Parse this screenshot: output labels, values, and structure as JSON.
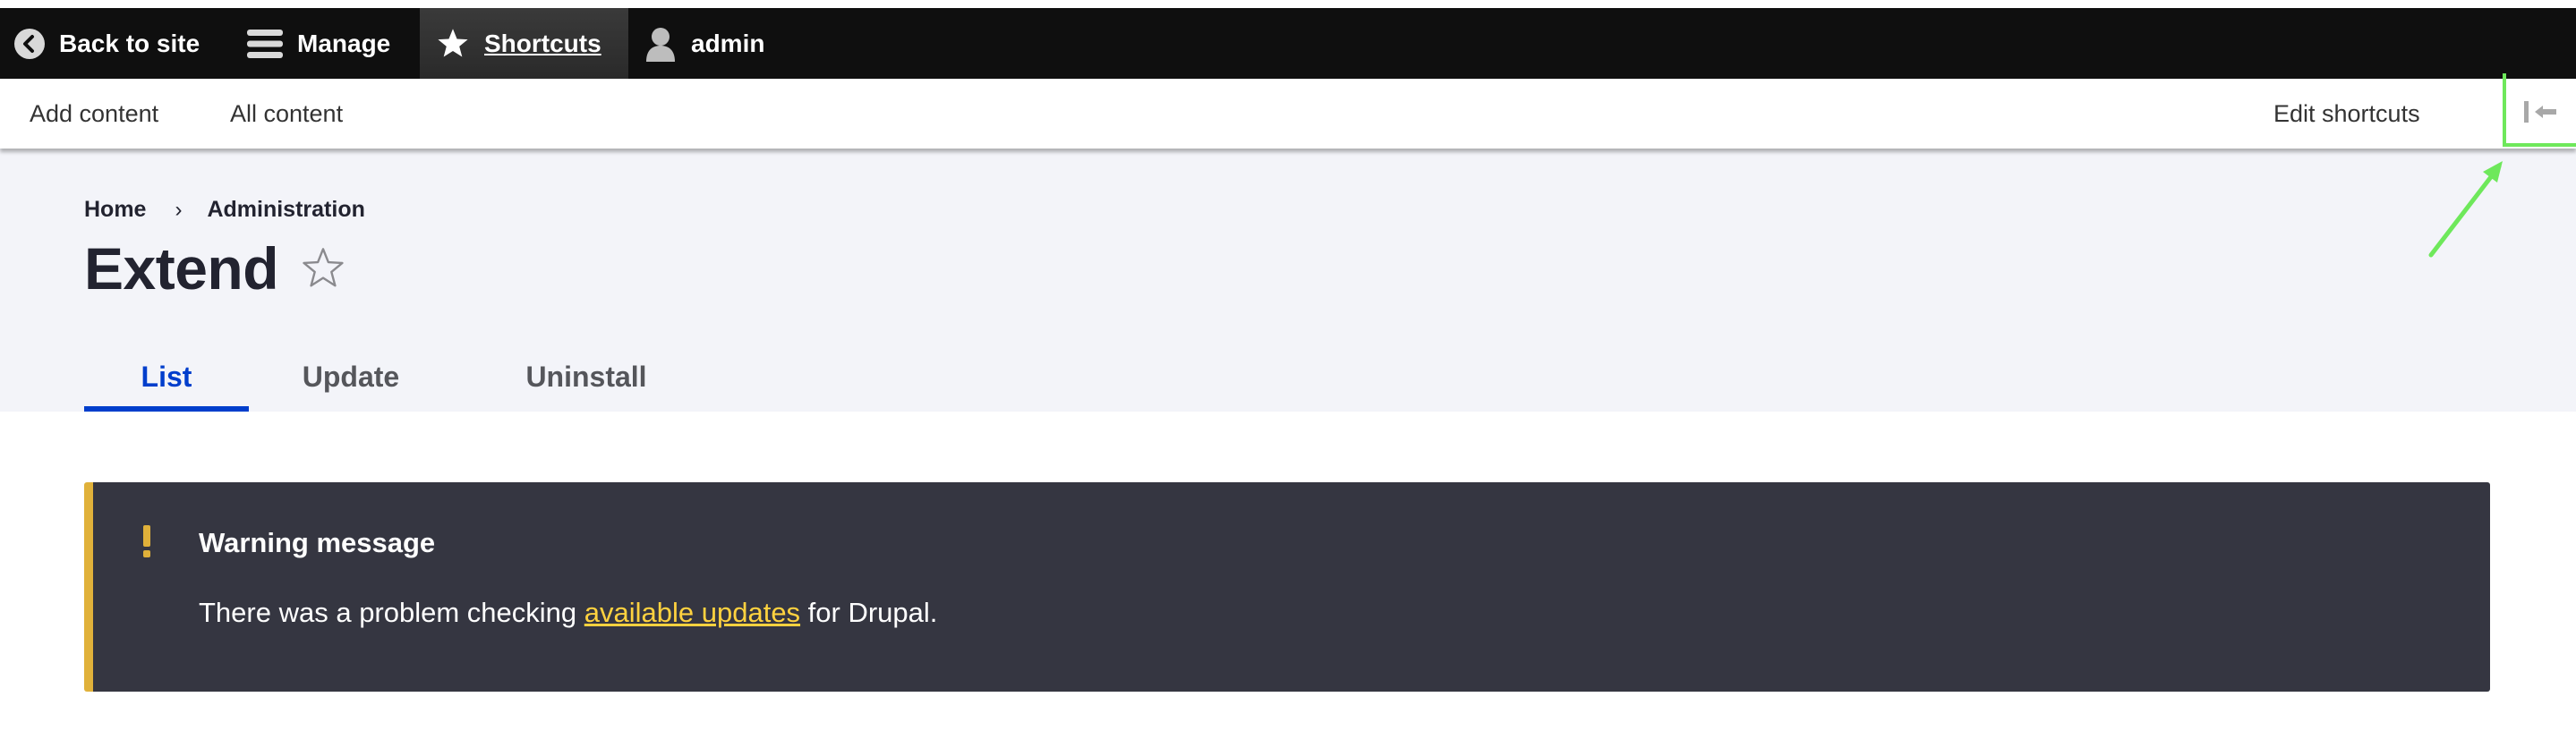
{
  "toolbar": {
    "back_label": "Back to site",
    "manage_label": "Manage",
    "shortcuts_label": "Shortcuts",
    "user_label": "admin"
  },
  "tray": {
    "add_content": "Add content",
    "all_content": "All content",
    "edit_shortcuts": "Edit shortcuts"
  },
  "breadcrumb": {
    "items": [
      "Home",
      "Administration"
    ],
    "separator": "›"
  },
  "page": {
    "title": "Extend",
    "star_glyph": "☆"
  },
  "tabs": [
    {
      "label": "List",
      "active": true
    },
    {
      "label": "Update",
      "active": false
    },
    {
      "label": "Uninstall",
      "active": false
    }
  ],
  "message": {
    "title": "Warning message",
    "text_before": "There was a problem checking ",
    "link_text": "available updates",
    "text_after": " for Drupal."
  },
  "colors": {
    "toolbar_bg": "#0f0f0f",
    "active_tab": "#003ecc",
    "warning_accent": "#e0b13a",
    "message_bg": "#353641",
    "link_yellow": "#ffd23f",
    "annotation_green": "#6ee85b"
  },
  "icons": {
    "back": "chevron-left-circle-icon",
    "manage": "hamburger-menu-icon",
    "shortcuts": "star-icon",
    "user": "user-icon",
    "toggle": "collapse-tray-icon",
    "warning": "exclamation-icon"
  }
}
